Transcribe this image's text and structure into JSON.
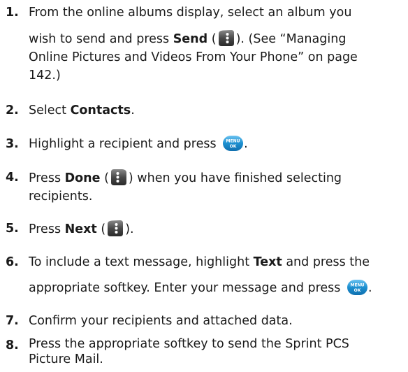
{
  "steps": [
    {
      "num": "1.",
      "l1": "From the online albums display, select an album you",
      "l2a": "wish to send and press ",
      "l2b": "Send",
      "l2c": " (",
      "l2d": "). (See “Managing",
      "l3": "Online Pictures and Videos From Your Phone” on page",
      "l4": "142.)"
    },
    {
      "num": "2.",
      "a": "Select ",
      "b": "Contacts",
      "c": "."
    },
    {
      "num": "3.",
      "a": "Highlight a recipient and press ",
      "c": "."
    },
    {
      "num": "4.",
      "a": "Press ",
      "b": "Done",
      "c": " (",
      "d": ") when you have finished selecting",
      "l2": "recipients."
    },
    {
      "num": "5.",
      "a": "Press ",
      "b": "Next",
      "c": " (",
      "d": ")."
    },
    {
      "num": "6.",
      "l1a": "To include a text message, highlight ",
      "l1b": "Text",
      "l1c": " and press the",
      "l2a": "appropriate softkey. Enter your message and press ",
      "l2c": "."
    },
    {
      "num": "7.",
      "a": "Confirm your recipients and attached data."
    },
    {
      "num": "8.",
      "l1": "Press the appropriate softkey to send the Sprint PCS",
      "l2": "Picture Mail."
    }
  ],
  "icons": {
    "softkey": "softkey-icon",
    "menu_ok": "menu-ok-icon",
    "menu_ok_text1": "MENU",
    "menu_ok_text2": "OK"
  },
  "colors": {
    "text": "#1a1a1a",
    "softkey_dark": "#3a3a3a",
    "menu_ok_blue": "#1c8fd0"
  }
}
